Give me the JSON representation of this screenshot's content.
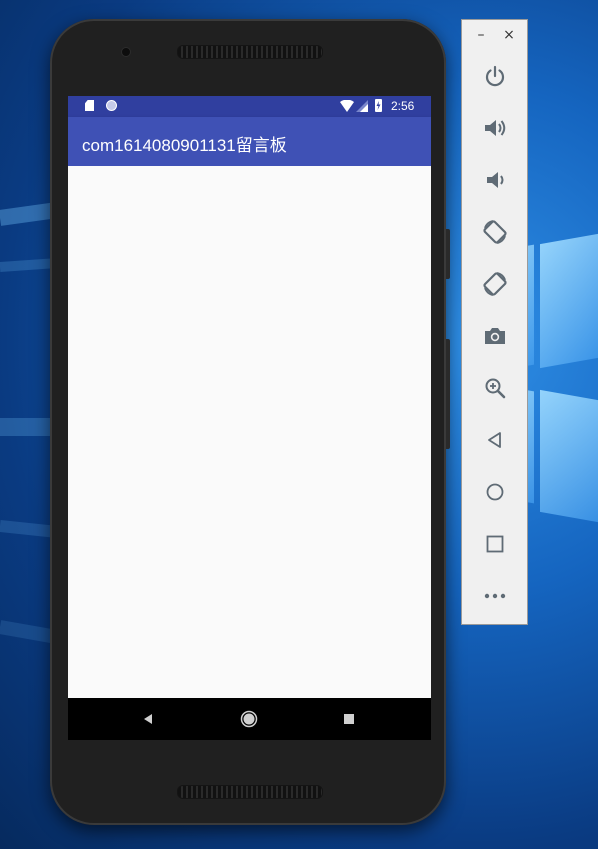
{
  "desktop": {
    "wallpaper": "windows-10-hero"
  },
  "device": {
    "status_bar": {
      "time": "2:56",
      "icons": [
        "sd-card-icon",
        "sync-circle-icon",
        "wifi-icon",
        "signal-icon",
        "battery-charging-icon"
      ]
    },
    "app_bar": {
      "title": "com1614080901131留言板"
    },
    "nav_bar": {
      "buttons": [
        "back-icon",
        "home-icon",
        "recents-icon"
      ]
    },
    "colors": {
      "status_bar": "#303f9f",
      "app_bar": "#3f51b5",
      "content_bg": "#fafafa"
    }
  },
  "emulator_toolbar": {
    "window_controls": {
      "minimize": "–",
      "close": "×"
    },
    "tools": [
      "power-icon",
      "volume-up-icon",
      "volume-down-icon",
      "rotate-left-icon",
      "rotate-right-icon",
      "screenshot-icon",
      "zoom-icon",
      "back-icon",
      "home-icon",
      "overview-icon",
      "more-icon"
    ]
  }
}
